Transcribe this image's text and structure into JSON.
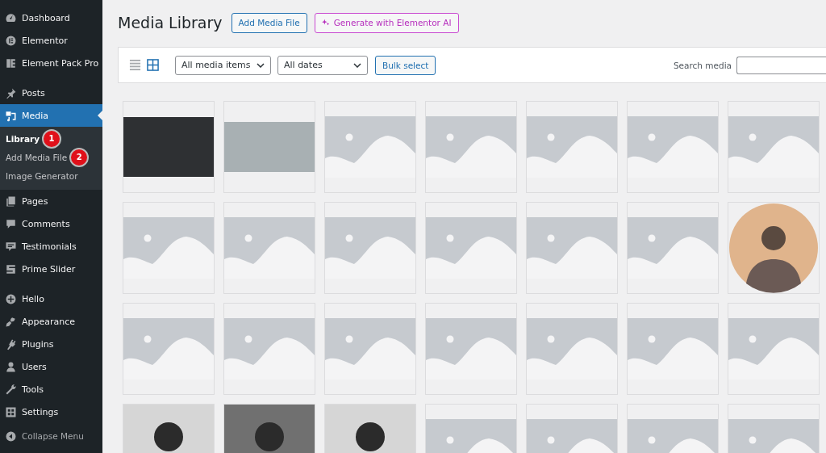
{
  "sidebar": {
    "groups": [
      {
        "items": [
          {
            "label": "Dashboard",
            "selected": false
          },
          {
            "label": "Elementor",
            "selected": false
          },
          {
            "label": "Element Pack Pro",
            "selected": false
          }
        ]
      },
      {
        "items": [
          {
            "label": "Posts",
            "selected": false
          },
          {
            "label": "Media",
            "selected": true,
            "children": [
              {
                "label": "Library",
                "selected": true,
                "badge": "1"
              },
              {
                "label": "Add Media File",
                "selected": false,
                "badge": "2"
              },
              {
                "label": "Image Generator",
                "selected": false
              }
            ]
          },
          {
            "label": "Pages",
            "selected": false
          },
          {
            "label": "Comments",
            "selected": false
          },
          {
            "label": "Testimonials",
            "selected": false
          },
          {
            "label": "Prime Slider",
            "selected": false
          }
        ]
      },
      {
        "items": [
          {
            "label": "Hello",
            "selected": false
          },
          {
            "label": "Appearance",
            "selected": false
          },
          {
            "label": "Plugins",
            "selected": false
          },
          {
            "label": "Users",
            "selected": false
          },
          {
            "label": "Tools",
            "selected": false
          },
          {
            "label": "Settings",
            "selected": false
          }
        ]
      }
    ],
    "collapse": "Collapse Menu"
  },
  "title": "Media Library",
  "buttons": [
    {
      "label": "Add Media File",
      "kind": "default"
    },
    {
      "label": "Generate with Elementor AI",
      "kind": "ai"
    }
  ],
  "toolbar": {
    "views": [
      {
        "kind": "list",
        "selected": false
      },
      {
        "kind": "grid",
        "selected": true
      }
    ],
    "filters": [
      "All media items",
      "All dates"
    ],
    "bulk": "Bulk select",
    "search_label": "Search media"
  },
  "items": [
    {
      "kind": "dark"
    },
    {
      "kind": "photo"
    },
    {
      "kind": "placeholder"
    },
    {
      "kind": "placeholder"
    },
    {
      "kind": "placeholder"
    },
    {
      "kind": "placeholder"
    },
    {
      "kind": "placeholder"
    },
    {
      "kind": "placeholder"
    },
    {
      "kind": "placeholder"
    },
    {
      "kind": "placeholder"
    },
    {
      "kind": "placeholder"
    },
    {
      "kind": "placeholder"
    },
    {
      "kind": "placeholder"
    },
    {
      "kind": "round-portrait"
    },
    {
      "kind": "placeholder"
    },
    {
      "kind": "placeholder"
    },
    {
      "kind": "placeholder"
    },
    {
      "kind": "placeholder"
    },
    {
      "kind": "placeholder"
    },
    {
      "kind": "placeholder"
    },
    {
      "kind": "placeholder"
    },
    {
      "kind": "portrait"
    },
    {
      "kind": "portrait"
    },
    {
      "kind": "portrait"
    },
    {
      "kind": "placeholder"
    },
    {
      "kind": "placeholder"
    },
    {
      "kind": "placeholder"
    },
    {
      "kind": "placeholder"
    }
  ]
}
